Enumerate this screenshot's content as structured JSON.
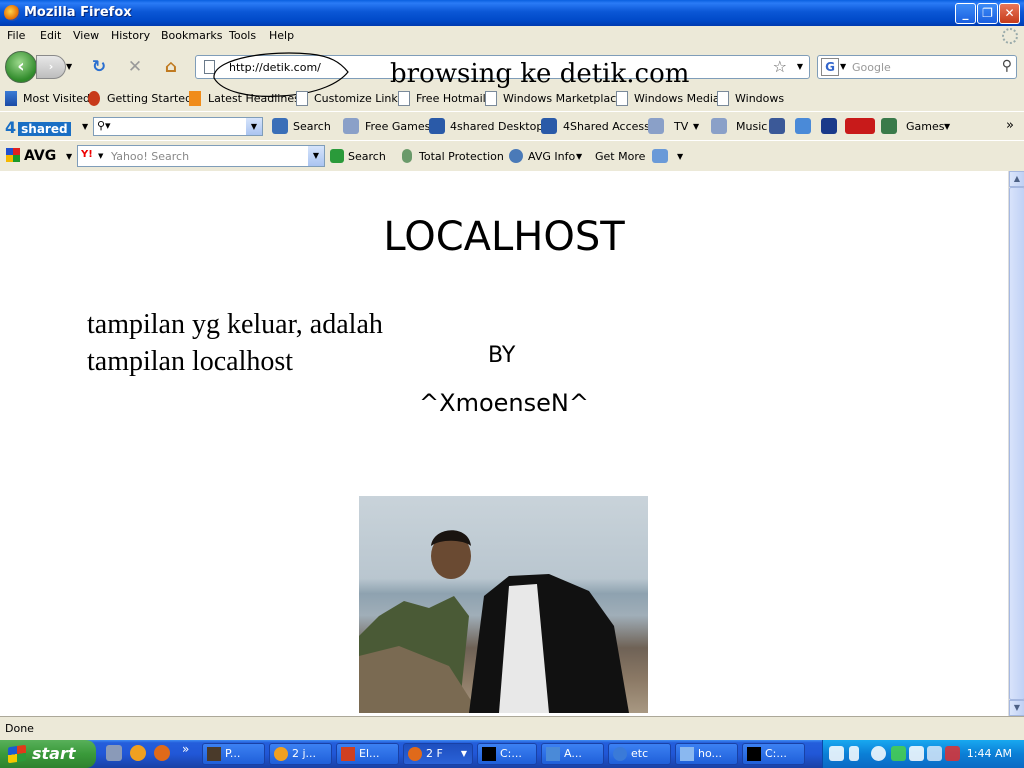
{
  "window": {
    "title": "Mozilla Firefox"
  },
  "menu": [
    "File",
    "Edit",
    "View",
    "History",
    "Bookmarks",
    "Tools",
    "Help"
  ],
  "nav": {
    "url": "http://detik.com/",
    "search_placeholder": "Google",
    "annotation": "browsing ke detik.com"
  },
  "bookmarks": [
    "Most Visited",
    "Getting Started",
    "Latest Headlines",
    "Customize Links",
    "Free Hotmail",
    "Windows Marketplace",
    "Windows Media",
    "Windows"
  ],
  "toolbar_4shared": {
    "logo_num": "4",
    "logo_text": "shared",
    "search": "Search",
    "items": [
      "Free Games",
      "4shared Desktop",
      "4Shared Access",
      "TV",
      "Music",
      "Games"
    ],
    "overflow": "»"
  },
  "toolbar_avg": {
    "logo": "AVG",
    "yahoo_prefix": "Y!",
    "yahoo_placeholder": "Yahoo! Search",
    "search": "Search",
    "total_protection": "Total Protection",
    "avg_info": "AVG Info",
    "get_more": "Get More"
  },
  "page": {
    "heading": "LOCALHOST",
    "paragraph": "tampilan yg keluar, adalah tampilan localhost",
    "by": "BY",
    "author": "^XmoenseN^"
  },
  "status": {
    "text": "Done"
  },
  "taskbar": {
    "start": "start",
    "quicklaunch_more": "»",
    "tasks": [
      "P...",
      "2 j...",
      "El...",
      "2 F",
      "C:...",
      "A...",
      "etc",
      "ho...",
      "C:..."
    ],
    "clock": "1:44 AM"
  }
}
